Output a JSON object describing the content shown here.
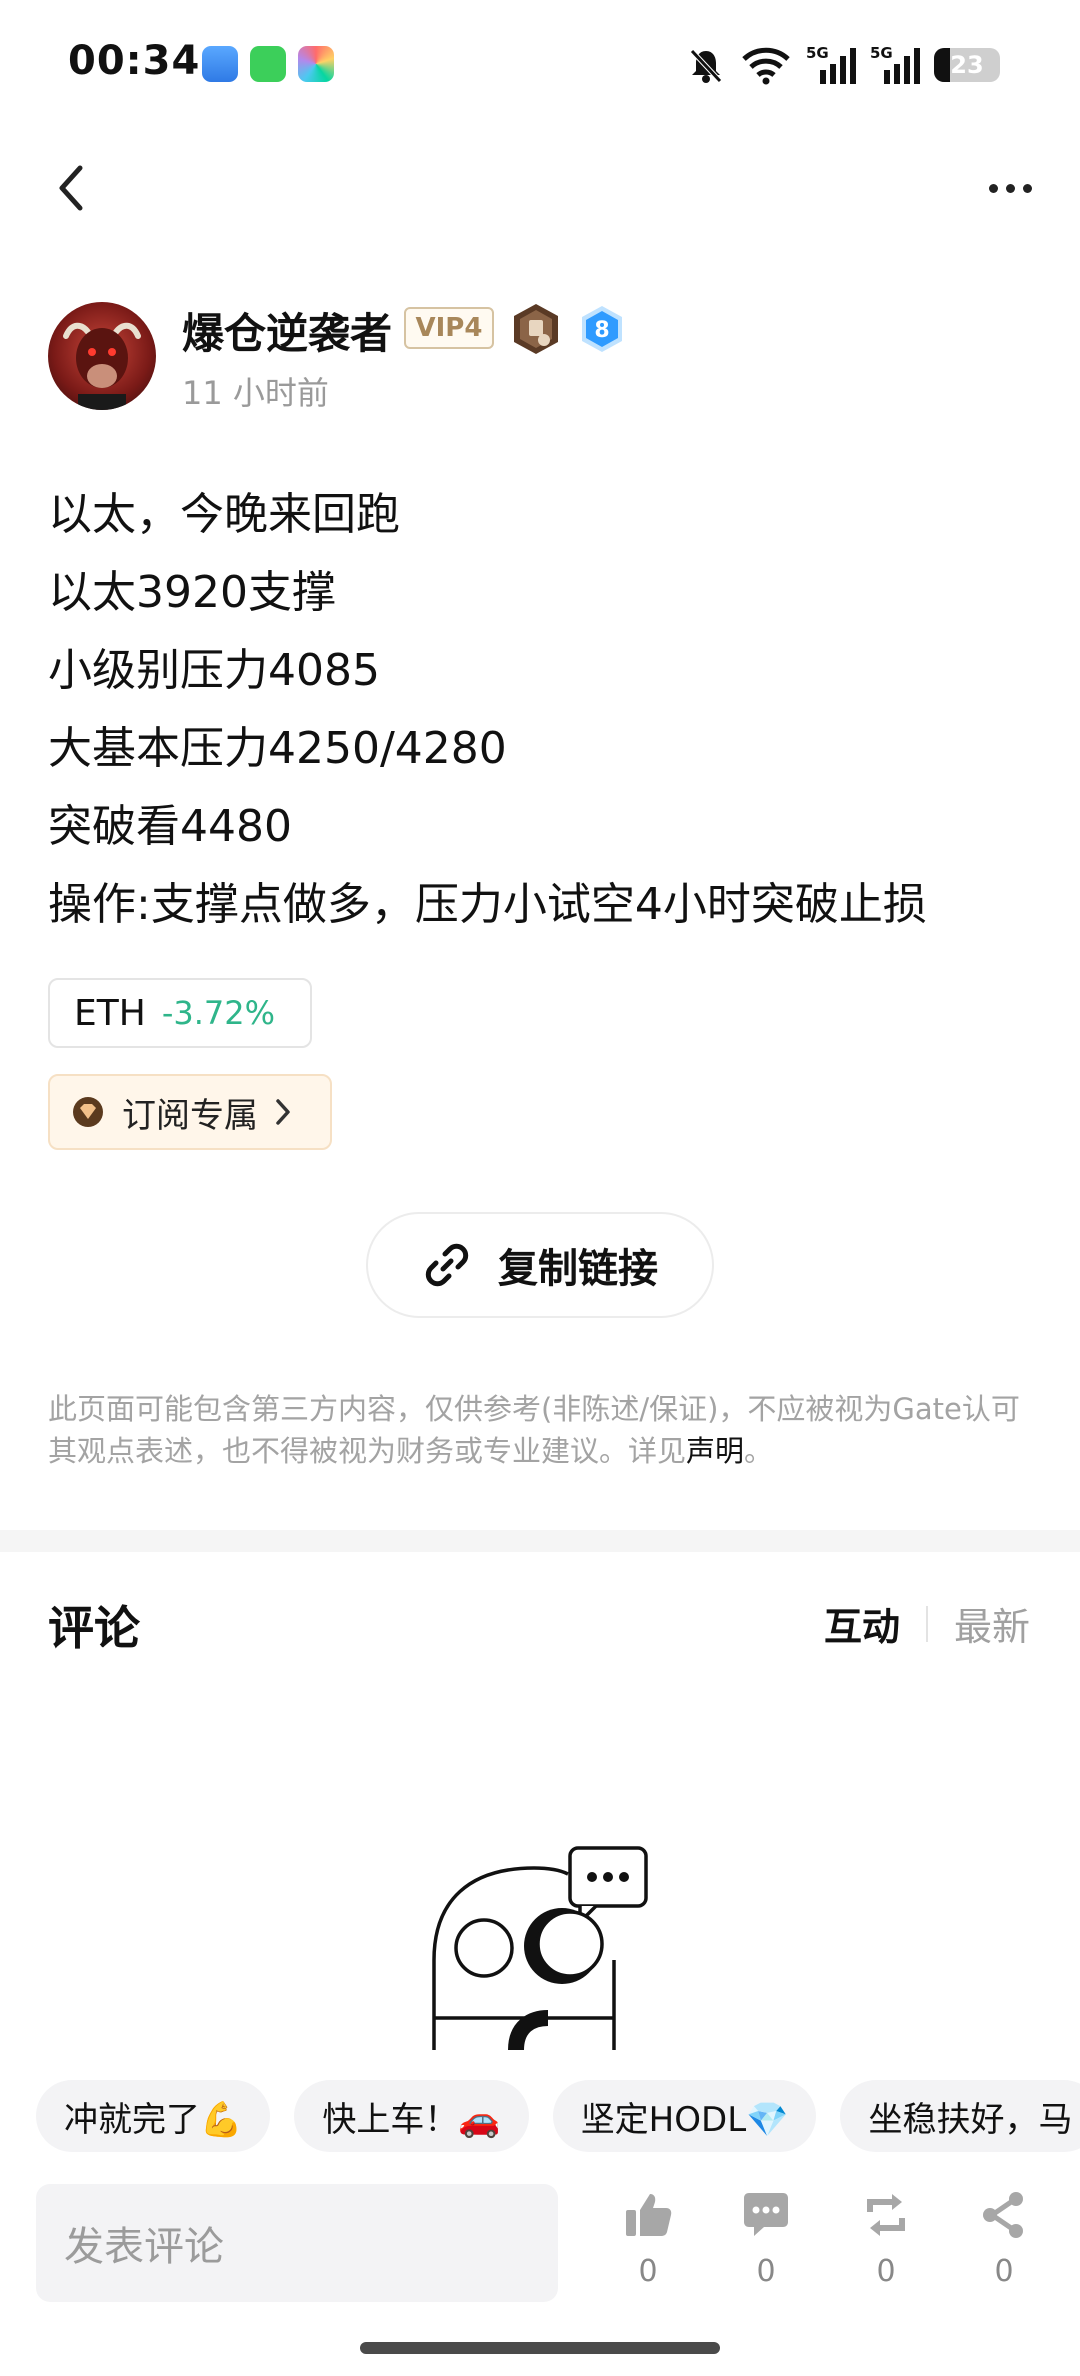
{
  "status_bar": {
    "time": "00:34",
    "battery": "23"
  },
  "author": {
    "name": "爆仓逆袭者",
    "vip": "VIP4",
    "level": "8",
    "post_time": "11 小时前"
  },
  "post": {
    "lines": [
      "以太，今晚来回跑",
      "以太3920支撑",
      "小级别压力4085",
      "大基本压力4250/4280",
      "突破看4480",
      "操作:支撑点做多，压力小试空4小时突破止损"
    ],
    "coin_tag": {
      "symbol": "ETH",
      "change": "-3.72%"
    },
    "subscribe_label": "订阅专属",
    "copy_link_label": "复制链接"
  },
  "disclaimer": {
    "text": "此页面可能包含第三方内容，仅供参考(非陈述/保证)，不应被视为Gate认可其观点表述，也不得被视为财务或专业建议。详见",
    "link": "声明",
    "suffix": "。"
  },
  "comments": {
    "title": "评论",
    "sort_tabs": [
      "互动",
      "最新"
    ],
    "active_tab": "互动"
  },
  "quick_replies": [
    "冲就完了💪",
    "快上车！🚗",
    "坚定HODL💎",
    "坐稳扶好，马"
  ],
  "bottom_bar": {
    "input_placeholder": "发表评论",
    "actions": [
      {
        "icon": "thumbs-up-icon",
        "count": "0"
      },
      {
        "icon": "comment-icon",
        "count": "0"
      },
      {
        "icon": "repost-icon",
        "count": "0"
      },
      {
        "icon": "share-icon",
        "count": "0"
      }
    ]
  },
  "colors": {
    "negative_change": "#2fb58a",
    "subscribe_bg": "#fff6ea",
    "vip_text": "#a8875a"
  }
}
